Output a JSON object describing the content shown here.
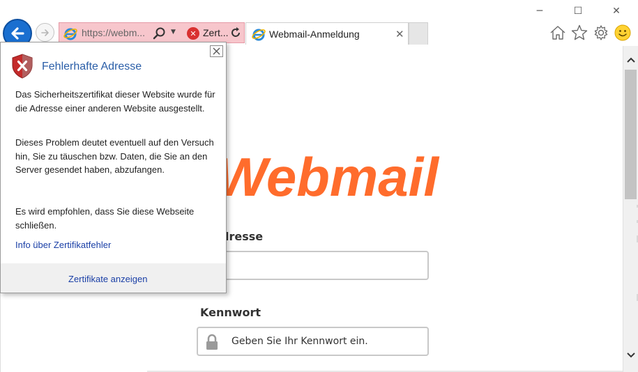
{
  "window": {
    "minimize_glyph": "─",
    "maximize_glyph": "☐",
    "close_glyph": "✕"
  },
  "navigation": {
    "back_icon": "back-arrow-icon",
    "forward_icon": "forward-arrow-icon"
  },
  "addressbar": {
    "url": "https://webm...",
    "certificate_label": "Zert...",
    "error_colour": "#f7c6cc"
  },
  "tabs": [
    {
      "title": "Webmail-Anmeldung",
      "close_glyph": "✕"
    }
  ],
  "toolbar": {
    "icons": [
      "home-icon",
      "favorites-star-icon",
      "settings-gear-icon",
      "feedback-smiley-icon"
    ]
  },
  "certificate_popup": {
    "title": "Fehlerhafte Adresse",
    "paragraph1": "Das Sicherheitszertifikat dieser Website wurde für die Adresse einer anderen Website ausgestellt.",
    "paragraph2": "Dieses Problem deutet eventuell auf den Versuch hin, Sie zu täuschen bzw. Daten, die Sie an den Server gesendet haben, abzufangen.",
    "paragraph3": "Es wird empfohlen, dass Sie diese Webseite schließen.",
    "info_link": "Info über Zertifikatfehler",
    "view_certificates": "Zertifikate anzeigen"
  },
  "page": {
    "logo_text": "Webmail",
    "logo_colour": "#ff6c2c",
    "email_label": "il-Adresse",
    "email_value": "",
    "password_label": "Kennwort",
    "password_placeholder": "Geben Sie Ihr Kennwort ein."
  }
}
